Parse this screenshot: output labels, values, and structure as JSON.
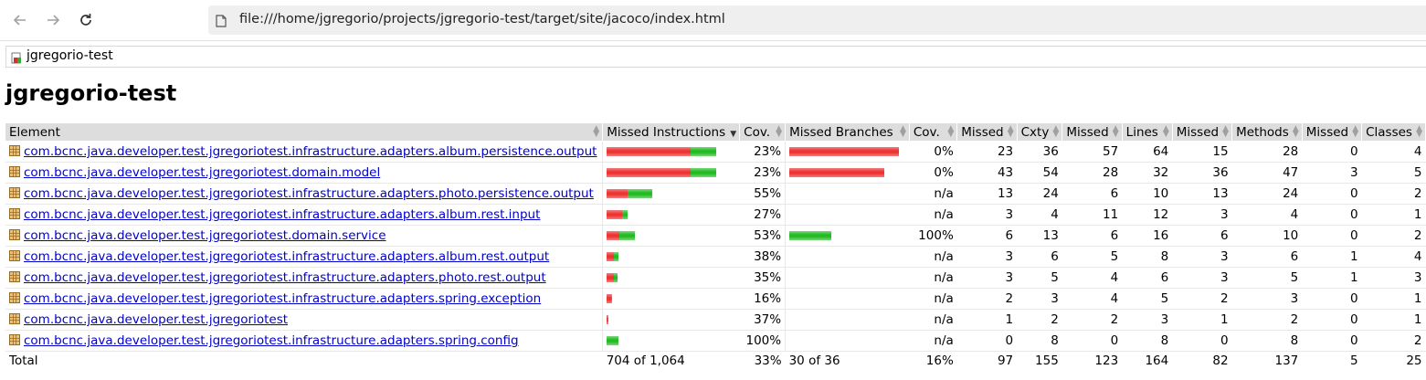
{
  "browser": {
    "url": "file:///home/jgregorio/projects/jgregorio-test/target/site/jacoco/index.html"
  },
  "breadcrumb": {
    "label": "jgregorio-test"
  },
  "page_title": "jgregorio-test",
  "table": {
    "headers": {
      "element": "Element",
      "missed_instructions": "Missed Instructions",
      "instr_cov": "Cov.",
      "missed_branches": "Missed Branches",
      "branch_cov": "Cov.",
      "missed_cxty": "Missed",
      "cxty": "Cxty",
      "missed_lines": "Missed",
      "lines": "Lines",
      "missed_methods": "Missed",
      "methods": "Methods",
      "missed_classes": "Missed",
      "classes": "Classes"
    },
    "rows": [
      {
        "name": "com.bcnc.java.developer.test.jgregoriotest.infrastructure.adapters.album.persistence.output",
        "instr_missed_frac": 0.77,
        "instr_total_frac": 1.0,
        "instr_cov": "23%",
        "branch_missed_frac": 1.0,
        "branch_total_frac": 1.0,
        "branch_cov": "0%",
        "missed_cxty": "23",
        "cxty": "36",
        "missed_lines": "57",
        "lines": "64",
        "missed_methods": "15",
        "methods": "28",
        "missed_classes": "0",
        "classes": "4"
      },
      {
        "name": "com.bcnc.java.developer.test.jgregoriotest.domain.model",
        "instr_missed_frac": 0.77,
        "instr_total_frac": 1.0,
        "instr_cov": "23%",
        "branch_missed_frac": 0.87,
        "branch_total_frac": 0.87,
        "branch_cov": "0%",
        "missed_cxty": "43",
        "cxty": "54",
        "missed_lines": "28",
        "lines": "32",
        "missed_methods": "36",
        "methods": "47",
        "missed_classes": "3",
        "classes": "5"
      },
      {
        "name": "com.bcnc.java.developer.test.jgregoriotest.infrastructure.adapters.photo.persistence.output",
        "instr_missed_frac": 0.19,
        "instr_total_frac": 0.42,
        "instr_cov": "55%",
        "branch_missed_frac": 0,
        "branch_total_frac": 0,
        "branch_cov": "n/a",
        "missed_cxty": "13",
        "cxty": "24",
        "missed_lines": "6",
        "lines": "10",
        "missed_methods": "13",
        "methods": "24",
        "missed_classes": "0",
        "classes": "2"
      },
      {
        "name": "com.bcnc.java.developer.test.jgregoriotest.infrastructure.adapters.album.rest.input",
        "instr_missed_frac": 0.14,
        "instr_total_frac": 0.19,
        "instr_cov": "27%",
        "branch_missed_frac": 0,
        "branch_total_frac": 0,
        "branch_cov": "n/a",
        "missed_cxty": "3",
        "cxty": "4",
        "missed_lines": "11",
        "lines": "12",
        "missed_methods": "3",
        "methods": "4",
        "missed_classes": "0",
        "classes": "1"
      },
      {
        "name": "com.bcnc.java.developer.test.jgregoriotest.domain.service",
        "instr_missed_frac": 0.12,
        "instr_total_frac": 0.26,
        "instr_cov": "53%",
        "branch_missed_frac": 0,
        "branch_total_frac": 0.38,
        "branch_cov": "100%",
        "missed_cxty": "6",
        "cxty": "13",
        "missed_lines": "6",
        "lines": "16",
        "missed_methods": "6",
        "methods": "10",
        "missed_classes": "0",
        "classes": "2"
      },
      {
        "name": "com.bcnc.java.developer.test.jgregoriotest.infrastructure.adapters.album.rest.output",
        "instr_missed_frac": 0.07,
        "instr_total_frac": 0.11,
        "instr_cov": "38%",
        "branch_missed_frac": 0,
        "branch_total_frac": 0,
        "branch_cov": "n/a",
        "missed_cxty": "3",
        "cxty": "6",
        "missed_lines": "5",
        "lines": "8",
        "missed_methods": "3",
        "methods": "6",
        "missed_classes": "1",
        "classes": "4"
      },
      {
        "name": "com.bcnc.java.developer.test.jgregoriotest.infrastructure.adapters.photo.rest.output",
        "instr_missed_frac": 0.07,
        "instr_total_frac": 0.1,
        "instr_cov": "35%",
        "branch_missed_frac": 0,
        "branch_total_frac": 0,
        "branch_cov": "n/a",
        "missed_cxty": "3",
        "cxty": "5",
        "missed_lines": "4",
        "lines": "6",
        "missed_methods": "3",
        "methods": "5",
        "missed_classes": "1",
        "classes": "3"
      },
      {
        "name": "com.bcnc.java.developer.test.jgregoriotest.infrastructure.adapters.spring.exception",
        "instr_missed_frac": 0.04,
        "instr_total_frac": 0.05,
        "instr_cov": "16%",
        "branch_missed_frac": 0,
        "branch_total_frac": 0,
        "branch_cov": "n/a",
        "missed_cxty": "2",
        "cxty": "3",
        "missed_lines": "4",
        "lines": "5",
        "missed_methods": "2",
        "methods": "3",
        "missed_classes": "0",
        "classes": "1"
      },
      {
        "name": "com.bcnc.java.developer.test.jgregoriotest",
        "instr_missed_frac": 0.01,
        "instr_total_frac": 0.02,
        "instr_cov": "37%",
        "branch_missed_frac": 0,
        "branch_total_frac": 0,
        "branch_cov": "n/a",
        "missed_cxty": "1",
        "cxty": "2",
        "missed_lines": "2",
        "lines": "3",
        "missed_methods": "1",
        "methods": "2",
        "missed_classes": "0",
        "classes": "1"
      },
      {
        "name": "com.bcnc.java.developer.test.jgregoriotest.infrastructure.adapters.spring.config",
        "instr_missed_frac": 0,
        "instr_total_frac": 0.11,
        "instr_cov": "100%",
        "branch_missed_frac": 0,
        "branch_total_frac": 0,
        "branch_cov": "n/a",
        "missed_cxty": "0",
        "cxty": "8",
        "missed_lines": "0",
        "lines": "8",
        "missed_methods": "0",
        "methods": "8",
        "missed_classes": "0",
        "classes": "2"
      }
    ],
    "total": {
      "label": "Total",
      "instr": "704 of 1,064",
      "instr_cov": "33%",
      "branch": "30 of 36",
      "branch_cov": "16%",
      "missed_cxty": "97",
      "cxty": "155",
      "missed_lines": "123",
      "lines": "164",
      "missed_methods": "82",
      "methods": "137",
      "missed_classes": "5",
      "classes": "25"
    }
  },
  "colors": {
    "missed": "#ee3333",
    "covered": "#22bb22",
    "link": "#0000cc"
  }
}
